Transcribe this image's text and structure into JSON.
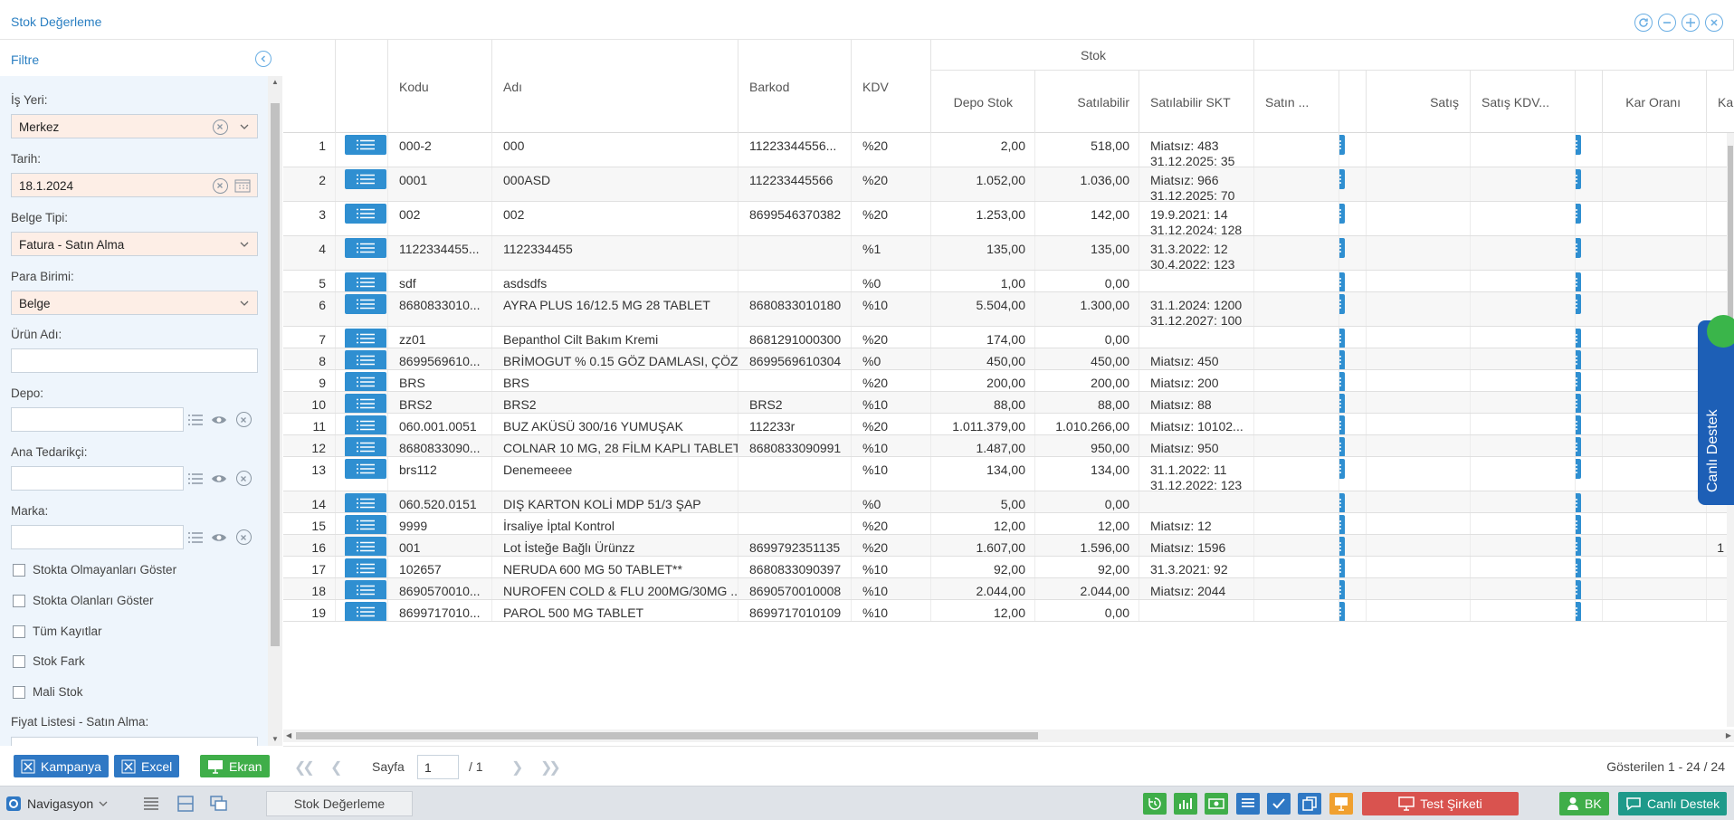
{
  "window": {
    "title": "Stok Değerleme"
  },
  "filter": {
    "title": "Filtre",
    "is_yeri": {
      "label": "İş Yeri:",
      "value": "Merkez"
    },
    "tarih": {
      "label": "Tarih:",
      "value": "18.1.2024"
    },
    "belge_tipi": {
      "label": "Belge Tipi:",
      "value": "Fatura - Satın Alma"
    },
    "para_birimi": {
      "label": "Para Birimi:",
      "value": "Belge"
    },
    "urun_adi": {
      "label": "Ürün Adı:",
      "value": ""
    },
    "depo": {
      "label": "Depo:",
      "value": ""
    },
    "ana_tedarikci": {
      "label": "Ana Tedarikçi:",
      "value": ""
    },
    "marka": {
      "label": "Marka:",
      "value": ""
    },
    "checks": [
      {
        "label": "Stokta Olmayanları Göster",
        "checked": false
      },
      {
        "label": "Stokta Olanları Göster",
        "checked": false
      },
      {
        "label": "Tüm Kayıtlar",
        "checked": false
      },
      {
        "label": "Stok Fark",
        "checked": false
      },
      {
        "label": "Mali Stok",
        "checked": false
      }
    ],
    "fiyat_listesi": {
      "label": "Fiyat Listesi - Satın Alma:"
    },
    "buttons": {
      "kampanya": "Kampanya",
      "excel": "Excel",
      "ekran": "Ekran"
    }
  },
  "grid": {
    "group_header": "Stok",
    "columns": {
      "kodu": "Kodu",
      "adi": "Adı",
      "barkod": "Barkod",
      "kdv": "KDV",
      "depo_stok": "Depo Stok",
      "satilabilir": "Satılabilir",
      "satilabilir_skt": "Satılabilir SKT",
      "satin": "Satın ...",
      "satis": "Satış",
      "satis_kdv": "Satış KDV...",
      "kar_orani": "Kar Oranı",
      "ka": "Ka"
    },
    "rows": [
      {
        "no": "1",
        "kodu": "000-2",
        "adi": "000",
        "barkod": "11223344556...",
        "kdv": "%20",
        "depo_stok": "2,00",
        "satilabilir": "518,00",
        "skt": [
          "Miatsız: 483",
          "31.12.2025: 35"
        ],
        "extra": ""
      },
      {
        "no": "2",
        "kodu": "0001",
        "adi": "000ASD",
        "barkod": "112233445566",
        "kdv": "%20",
        "depo_stok": "1.052,00",
        "satilabilir": "1.036,00",
        "skt": [
          "Miatsız: 966",
          "31.12.2025: 70"
        ],
        "extra": ""
      },
      {
        "no": "3",
        "kodu": "002",
        "adi": "002",
        "barkod": "8699546370382",
        "kdv": "%20",
        "depo_stok": "1.253,00",
        "satilabilir": "142,00",
        "skt": [
          "19.9.2021: 14",
          "31.12.2024: 128"
        ],
        "extra": ""
      },
      {
        "no": "4",
        "kodu": "1122334455...",
        "adi": "1122334455",
        "barkod": "",
        "kdv": "%1",
        "depo_stok": "135,00",
        "satilabilir": "135,00",
        "skt": [
          "31.3.2022: 12",
          "30.4.2022: 123"
        ],
        "extra": ""
      },
      {
        "no": "5",
        "kodu": "sdf",
        "adi": "asdsdfs",
        "barkod": "",
        "kdv": "%0",
        "depo_stok": "1,00",
        "satilabilir": "0,00",
        "skt": [],
        "extra": ""
      },
      {
        "no": "6",
        "kodu": "8680833010...",
        "adi": "AYRA PLUS 16/12.5 MG 28 TABLET",
        "barkod": "8680833010180",
        "kdv": "%10",
        "depo_stok": "5.504,00",
        "satilabilir": "1.300,00",
        "skt": [
          "31.1.2024: 1200",
          "31.12.2027: 100"
        ],
        "extra": ""
      },
      {
        "no": "7",
        "kodu": "zz01",
        "adi": "Bepanthol Cilt Bakım Kremi",
        "barkod": "8681291000300",
        "kdv": "%20",
        "depo_stok": "174,00",
        "satilabilir": "0,00",
        "skt": [],
        "extra": ""
      },
      {
        "no": "8",
        "kodu": "8699569610...",
        "adi": "BRİMOGUT % 0.15 GÖZ DAMLASI, ÇÖZ...",
        "barkod": "8699569610304",
        "kdv": "%0",
        "depo_stok": "450,00",
        "satilabilir": "450,00",
        "skt": [
          "Miatsız: 450"
        ],
        "extra": ""
      },
      {
        "no": "9",
        "kodu": "BRS",
        "adi": "BRS",
        "barkod": "",
        "kdv": "%20",
        "depo_stok": "200,00",
        "satilabilir": "200,00",
        "skt": [
          "Miatsız: 200"
        ],
        "extra": ""
      },
      {
        "no": "10",
        "kodu": "BRS2",
        "adi": "BRS2",
        "barkod": "BRS2",
        "kdv": "%10",
        "depo_stok": "88,00",
        "satilabilir": "88,00",
        "skt": [
          "Miatsız: 88"
        ],
        "extra": ""
      },
      {
        "no": "11",
        "kodu": "060.001.0051",
        "adi": "BUZ AKÜSÜ 300/16 YUMUŞAK",
        "barkod": "112233r",
        "kdv": "%20",
        "depo_stok": "1.011.379,00",
        "satilabilir": "1.010.266,00",
        "skt": [
          "Miatsız: 10102..."
        ],
        "extra": ""
      },
      {
        "no": "12",
        "kodu": "8680833090...",
        "adi": "COLNAR 10 MG, 28 FİLM KAPLI TABLET",
        "barkod": "8680833090991",
        "kdv": "%10",
        "depo_stok": "1.487,00",
        "satilabilir": "950,00",
        "skt": [
          "Miatsız: 950"
        ],
        "extra": ""
      },
      {
        "no": "13",
        "kodu": "brs112",
        "adi": "Denemeeee",
        "barkod": "",
        "kdv": "%10",
        "depo_stok": "134,00",
        "satilabilir": "134,00",
        "skt": [
          "31.1.2022: 11",
          "31.12.2022: 123"
        ],
        "extra": ""
      },
      {
        "no": "14",
        "kodu": "060.520.0151",
        "adi": "DIŞ KARTON KOLİ MDP 51/3 ŞAP",
        "barkod": "",
        "kdv": "%0",
        "depo_stok": "5,00",
        "satilabilir": "0,00",
        "skt": [],
        "extra": ""
      },
      {
        "no": "15",
        "kodu": "9999",
        "adi": "İrsaliye İptal Kontrol",
        "barkod": "",
        "kdv": "%20",
        "depo_stok": "12,00",
        "satilabilir": "12,00",
        "skt": [
          "Miatsız: 12"
        ],
        "extra": ""
      },
      {
        "no": "16",
        "kodu": "001",
        "adi": "Lot İsteğe Bağlı Ürünzz",
        "barkod": "8699792351135",
        "kdv": "%20",
        "depo_stok": "1.607,00",
        "satilabilir": "1.596,00",
        "skt": [
          "Miatsız: 1596"
        ],
        "extra": "1"
      },
      {
        "no": "17",
        "kodu": "102657",
        "adi": "NERUDA 600 MG 50 TABLET**",
        "barkod": "8680833090397",
        "kdv": "%10",
        "depo_stok": "92,00",
        "satilabilir": "92,00",
        "skt": [
          "31.3.2021: 92"
        ],
        "extra": ""
      },
      {
        "no": "18",
        "kodu": "8690570010...",
        "adi": "NUROFEN COLD & FLU 200MG/30MG ...",
        "barkod": "8690570010008",
        "kdv": "%10",
        "depo_stok": "2.044,00",
        "satilabilir": "2.044,00",
        "skt": [
          "Miatsız: 2044"
        ],
        "extra": ""
      },
      {
        "no": "19",
        "kodu": "8699717010...",
        "adi": "PAROL 500 MG TABLET",
        "barkod": "8699717010109",
        "kdv": "%10",
        "depo_stok": "12,00",
        "satilabilir": "0,00",
        "skt": [],
        "extra": ""
      }
    ]
  },
  "pager": {
    "page_label": "Sayfa",
    "page": "1",
    "of": "/ 1",
    "summary": "Gösterilen 1 - 24 / 24"
  },
  "live_support": {
    "label": "Canlı Destek"
  },
  "taskbar": {
    "nav": "Navigasyon",
    "task": "Stok Değerleme",
    "company": "Test Şirketi",
    "user": "BK",
    "support": "Canlı Destek"
  }
}
